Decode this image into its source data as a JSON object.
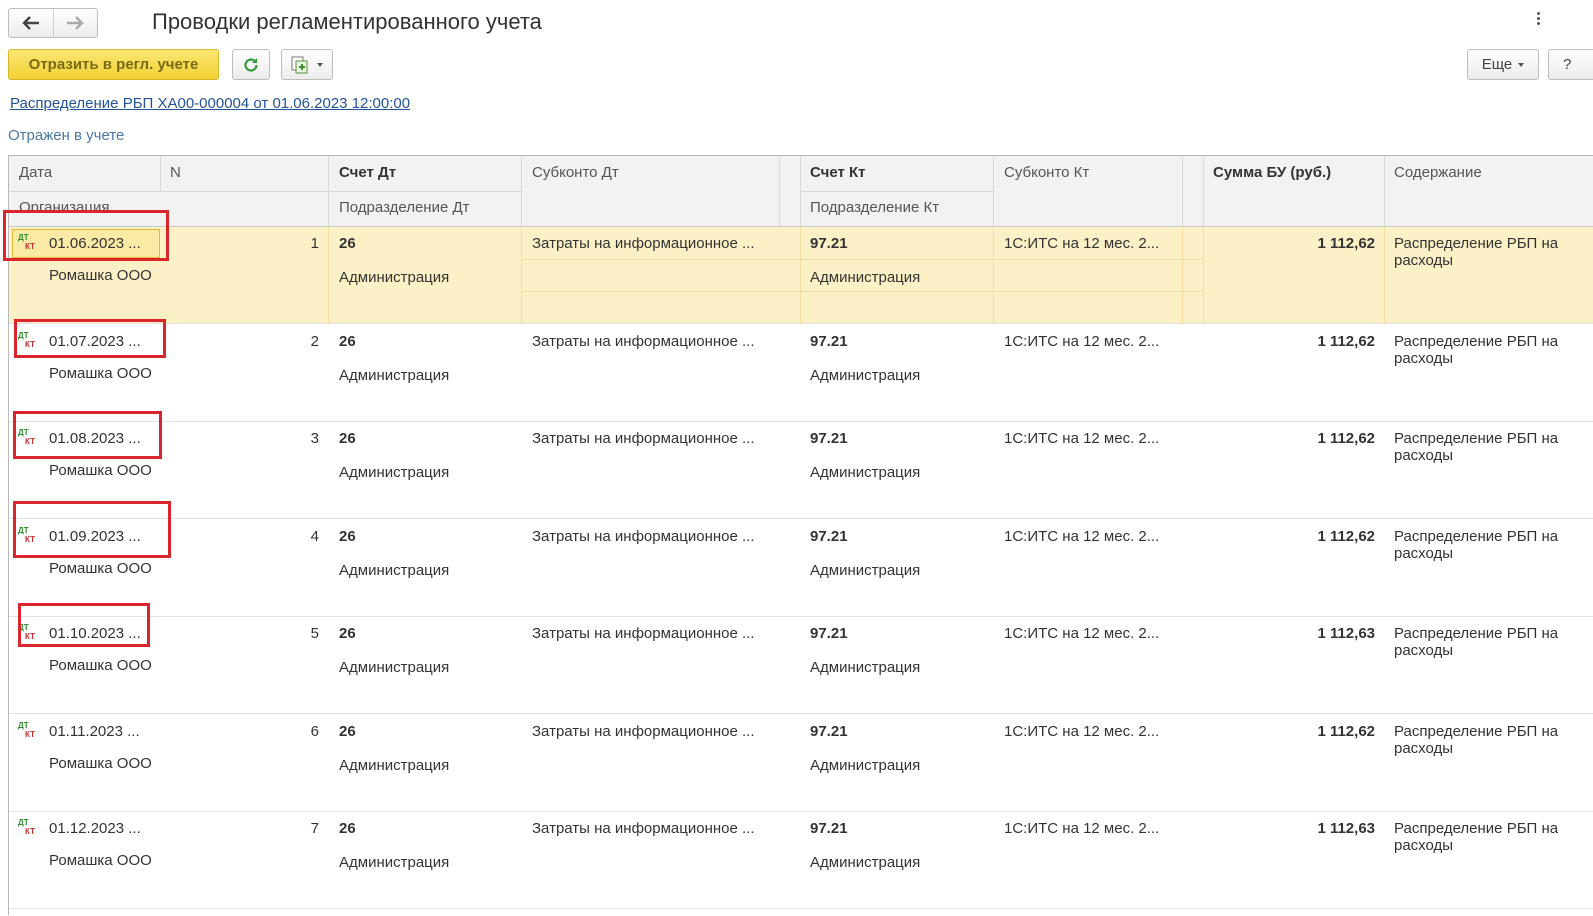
{
  "header": {
    "back_icon": "arrow-left-icon",
    "forward_icon": "arrow-right-icon",
    "title": "Проводки регламентированного учета"
  },
  "toolbar": {
    "reflect_label": "Отразить в регл. учете",
    "refresh_icon": "refresh-icon",
    "report_icon": "report-icon",
    "more_label": "Еще",
    "help_label": "?"
  },
  "document_link": "Распределение РБП ХА00-000004 от 01.06.2023 12:00:00",
  "status": "Отражен в учете",
  "columns": {
    "date": "Дата",
    "n": "N",
    "organization": "Организация",
    "account_dt": "Счет Дт",
    "division_dt": "Подразделение Дт",
    "subconto_dt": "Субконто Дт",
    "account_kt": "Счет Кт",
    "division_kt": "Подразделение Кт",
    "subconto_kt": "Субконто Кт",
    "sum": "Сумма БУ (руб.)",
    "content": "Содержание"
  },
  "rows": [
    {
      "date": "01.06.2023 ...",
      "n": "1",
      "org": "Ромашка ООО",
      "acc_dt": "26",
      "div_dt": "Администрация",
      "sub_dt": "Затраты на информационное ...",
      "acc_kt": "97.21",
      "div_kt": "Администрация",
      "sub_kt": "1С:ИТС на 12 мес. 2...",
      "sum": "1 112,62",
      "content1": "Распределение РБП на",
      "content2": "расходы"
    },
    {
      "date": "01.07.2023 ...",
      "n": "2",
      "org": "Ромашка ООО",
      "acc_dt": "26",
      "div_dt": "Администрация",
      "sub_dt": "Затраты на информационное ...",
      "acc_kt": "97.21",
      "div_kt": "Администрация",
      "sub_kt": "1С:ИТС на 12 мес. 2...",
      "sum": "1 112,62",
      "content1": "Распределение РБП на",
      "content2": "расходы"
    },
    {
      "date": "01.08.2023 ...",
      "n": "3",
      "org": "Ромашка ООО",
      "acc_dt": "26",
      "div_dt": "Администрация",
      "sub_dt": "Затраты на информационное ...",
      "acc_kt": "97.21",
      "div_kt": "Администрация",
      "sub_kt": "1С:ИТС на 12 мес. 2...",
      "sum": "1 112,62",
      "content1": "Распределение РБП на",
      "content2": "расходы"
    },
    {
      "date": "01.09.2023 ...",
      "n": "4",
      "org": "Ромашка ООО",
      "acc_dt": "26",
      "div_dt": "Администрация",
      "sub_dt": "Затраты на информационное ...",
      "acc_kt": "97.21",
      "div_kt": "Администрация",
      "sub_kt": "1С:ИТС на 12 мес. 2...",
      "sum": "1 112,62",
      "content1": "Распределение РБП на",
      "content2": "расходы"
    },
    {
      "date": "01.10.2023 ...",
      "n": "5",
      "org": "Ромашка ООО",
      "acc_dt": "26",
      "div_dt": "Администрация",
      "sub_dt": "Затраты на информационное ...",
      "acc_kt": "97.21",
      "div_kt": "Администрация",
      "sub_kt": "1С:ИТС на 12 мес. 2...",
      "sum": "1 112,63",
      "content1": "Распределение РБП на",
      "content2": "расходы"
    },
    {
      "date": "01.11.2023 ...",
      "n": "6",
      "org": "Ромашка ООО",
      "acc_dt": "26",
      "div_dt": "Администрация",
      "sub_dt": "Затраты на информационное ...",
      "acc_kt": "97.21",
      "div_kt": "Администрация",
      "sub_kt": "1С:ИТС на 12 мес. 2...",
      "sum": "1 112,62",
      "content1": "Распределение РБП на",
      "content2": "расходы"
    },
    {
      "date": "01.12.2023 ...",
      "n": "7",
      "org": "Ромашка ООО",
      "acc_dt": "26",
      "div_dt": "Администрация",
      "sub_dt": "Затраты на информационное ...",
      "acc_kt": "97.21",
      "div_kt": "Администрация",
      "sub_kt": "1С:ИТС на 12 мес. 2...",
      "sum": "1 112,63",
      "content1": "Распределение РБП на",
      "content2": "расходы"
    }
  ],
  "entry_icon": {
    "dt": "ДТ",
    "kt": "КТ"
  },
  "colors": {
    "accent_yellow": "#f2d235",
    "selected_row": "#fcf0c6",
    "highlight_box": "#d9252b",
    "link": "#23549a"
  }
}
